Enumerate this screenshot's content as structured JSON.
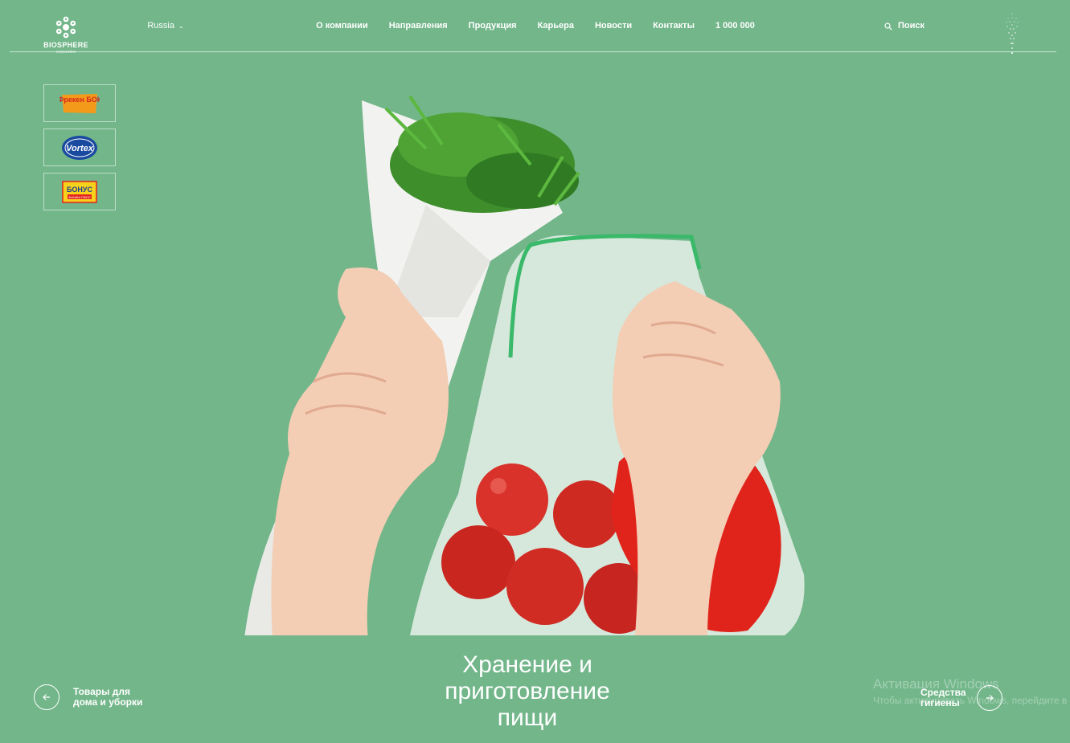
{
  "colors": {
    "background": "#72b68a",
    "text": "#ffffff",
    "accent_green": "#3ab96a"
  },
  "header": {
    "logo": {
      "name": "BIOSPHERE",
      "sub": "corporation",
      "icon": "snowflake-logo-icon"
    },
    "region": {
      "label": "Russia",
      "icon": "chevron-down-icon"
    },
    "nav": [
      "О компании",
      "Направления",
      "Продукция",
      "Карьера",
      "Новости",
      "Контакты",
      "1 000 000"
    ],
    "search": {
      "label": "Поиск",
      "icon": "search-icon"
    },
    "decor_icon": "fountain-icon"
  },
  "hero": {
    "brands": [
      {
        "name": "Фрекен БОК"
      },
      {
        "name": "Vortex"
      },
      {
        "name": "БОНУС",
        "sub": "ФИНИШ ПЛЮС"
      }
    ]
  },
  "slider": {
    "prev": {
      "label": "Товары для дома и уборки",
      "icon": "arrow-left-icon"
    },
    "current": "Хранение и приготовление пищи",
    "next": {
      "label": "Средства гигиены",
      "icon": "arrow-right-icon"
    }
  },
  "watermark": {
    "line1": "Активация Windows",
    "line2": "Чтобы активировать Windows, перейдите в раздел \"Параметры\"."
  }
}
